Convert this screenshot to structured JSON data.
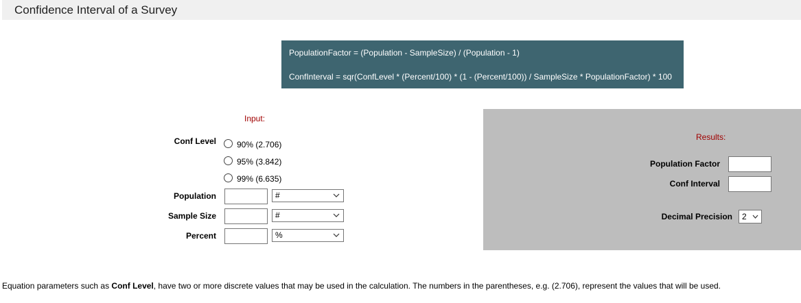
{
  "title": "Confidence Interval of a Survey",
  "formula": {
    "line1": "PopulationFactor = (Population - SampleSize) / (Population - 1)",
    "line2": "ConfInterval = sqr(ConfLevel * (Percent/100) * (1 - (Percent/100)) / SampleSize * PopulationFactor) * 100"
  },
  "input": {
    "heading": "Input:",
    "conf_level_label": "Conf Level",
    "conf_options": [
      "90% (2.706)",
      "95% (3.842)",
      "99% (6.635)"
    ],
    "population_label": "Population",
    "population_value": "",
    "population_unit": "#",
    "sample_size_label": "Sample Size",
    "sample_size_value": "",
    "sample_size_unit": "#",
    "percent_label": "Percent",
    "percent_value": "",
    "percent_unit": "%"
  },
  "results": {
    "heading": "Results:",
    "population_factor_label": "Population Factor",
    "population_factor_value": "",
    "conf_interval_label": "Conf Interval",
    "conf_interval_value": "",
    "decimal_precision_label": "Decimal Precision",
    "decimal_precision_value": "2"
  },
  "footnote": {
    "prefix": "Equation parameters such as ",
    "bold": "Conf Level",
    "suffix": ", have two or more discrete values that may be used in the calculation. The numbers in the parentheses, e.g. (2.706), represent the values that will be used."
  }
}
